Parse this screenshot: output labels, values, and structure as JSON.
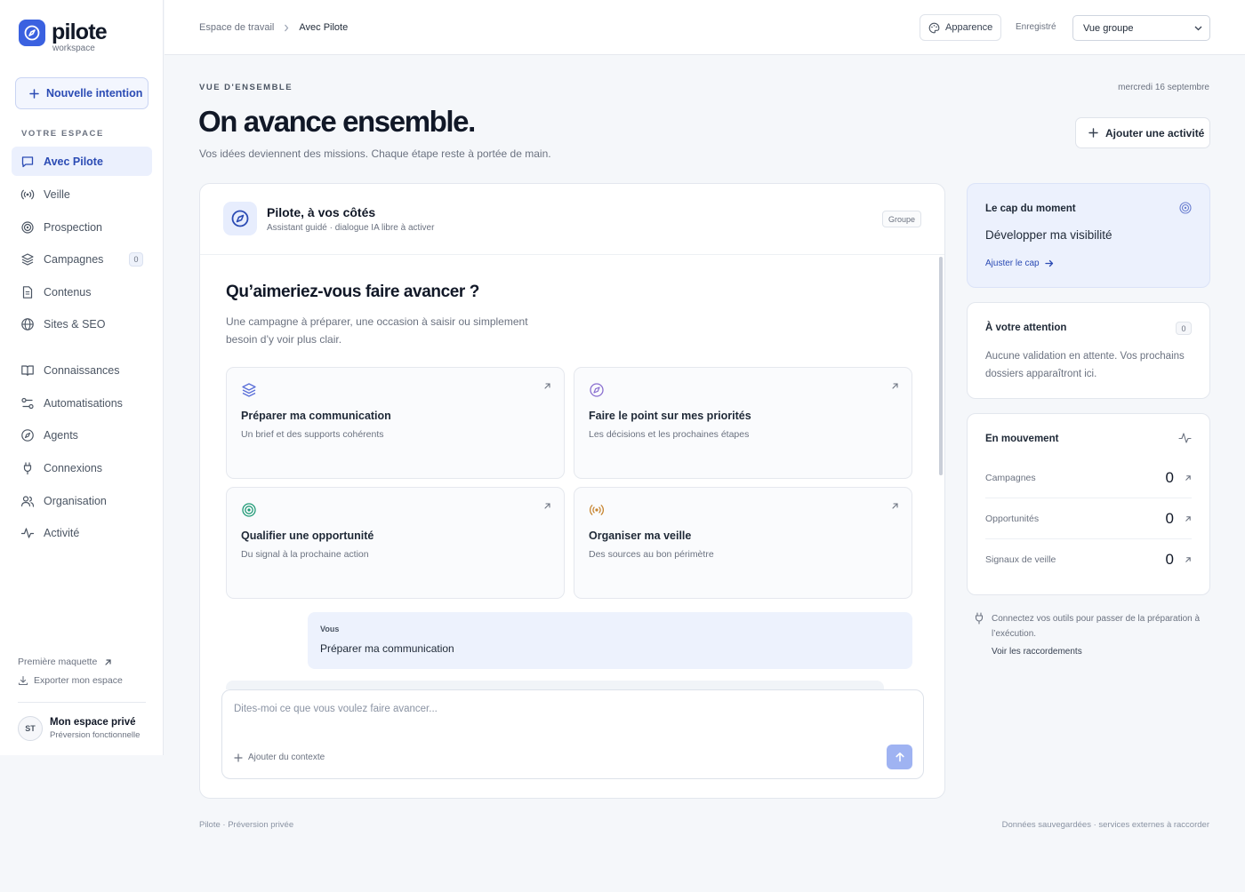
{
  "brand": {
    "name": "pilote",
    "subtitle": "workspace",
    "color": "#3a61e0"
  },
  "sidebar": {
    "new_button": "Nouvelle intention",
    "section_label": "VOTRE ESPACE",
    "items": [
      {
        "label": "Avec Pilote",
        "icon": "chat-icon",
        "active": true
      },
      {
        "label": "Veille",
        "icon": "broadcast-icon"
      },
      {
        "label": "Prospection",
        "icon": "target-icon"
      },
      {
        "label": "Campagnes",
        "icon": "layers-icon",
        "badge": "0"
      },
      {
        "label": "Contenus",
        "icon": "document-icon"
      },
      {
        "label": "Sites & SEO",
        "icon": "globe-icon"
      },
      {
        "label": "Connaissances",
        "icon": "book-icon"
      },
      {
        "label": "Automatisations",
        "icon": "workflow-icon"
      },
      {
        "label": "Agents",
        "icon": "compass-icon"
      },
      {
        "label": "Connexions",
        "icon": "plug-icon"
      },
      {
        "label": "Organisation",
        "icon": "users-icon"
      },
      {
        "label": "Activité",
        "icon": "activity-icon"
      }
    ],
    "links": [
      {
        "label": "Première maquette",
        "icon": "arrow-up-right-icon"
      },
      {
        "label": "Exporter mon espace",
        "icon": "download-icon"
      }
    ],
    "user": {
      "initials": "ST",
      "name": "Mon espace privé",
      "subtitle": "Préversion fonctionnelle"
    }
  },
  "topbar": {
    "breadcrumb": [
      "Espace de travail",
      "Avec Pilote"
    ],
    "appearance_button": "Apparence",
    "saved_label": "Enregistré",
    "view_select": "Vue groupe"
  },
  "header": {
    "eyebrow": "VUE D'ENSEMBLE",
    "date": "mercredi 16 septembre",
    "title": "On avance ensemble.",
    "subtitle": "Vos idées deviennent des missions. Chaque étape reste à portée de main.",
    "add_button": "Ajouter une activité"
  },
  "assistant": {
    "title": "Pilote, à vos côtés",
    "subtitle": "Assistant guidé · dialogue IA libre à activer",
    "badge": "Groupe",
    "question": "Qu’aimeriez-vous faire avancer ?",
    "question_sub": "Une campagne à préparer, une occasion à saisir ou simplement besoin d’y voir plus clair.",
    "suggestions": [
      {
        "title": "Préparer ma communication",
        "desc": "Un brief et des supports cohérents",
        "icon": "layers-icon",
        "color": "#5b6fd8"
      },
      {
        "title": "Faire le point sur mes priorités",
        "desc": "Les décisions et les prochaines étapes",
        "icon": "compass-icon",
        "color": "#8a6fd0"
      },
      {
        "title": "Qualifier une opportunité",
        "desc": "Du signal à la prochaine action",
        "icon": "target-icon",
        "color": "#1f9a76"
      },
      {
        "title": "Organiser ma veille",
        "desc": "Des sources au bon périmètre",
        "icon": "broadcast-icon",
        "color": "#c7842f"
      }
    ],
    "message": {
      "author": "Vous",
      "text": "Préparer ma communication"
    },
    "composer": {
      "placeholder": "Dites-moi ce que vous voulez faire avancer...",
      "context_button": "Ajouter du contexte"
    }
  },
  "right": {
    "cap": {
      "title": "Le cap du moment",
      "value": "Développer ma visibilité",
      "link": "Ajuster le cap"
    },
    "attention": {
      "title": "À votre attention",
      "count": "0",
      "text": "Aucune validation en attente. Vos prochains dossiers apparaîtront ici."
    },
    "movement": {
      "title": "En mouvement",
      "rows": [
        {
          "label": "Campagnes",
          "value": "0"
        },
        {
          "label": "Opportunités",
          "value": "0"
        },
        {
          "label": "Signaux de veille",
          "value": "0"
        }
      ]
    },
    "note": {
      "text": "Connectez vos outils pour passer de la préparation à l’exécution.",
      "link": "Voir les raccordements"
    }
  },
  "footer": {
    "left": "Pilote · Préversion privée",
    "right": "Données sauvegardées · services externes à raccorder"
  }
}
